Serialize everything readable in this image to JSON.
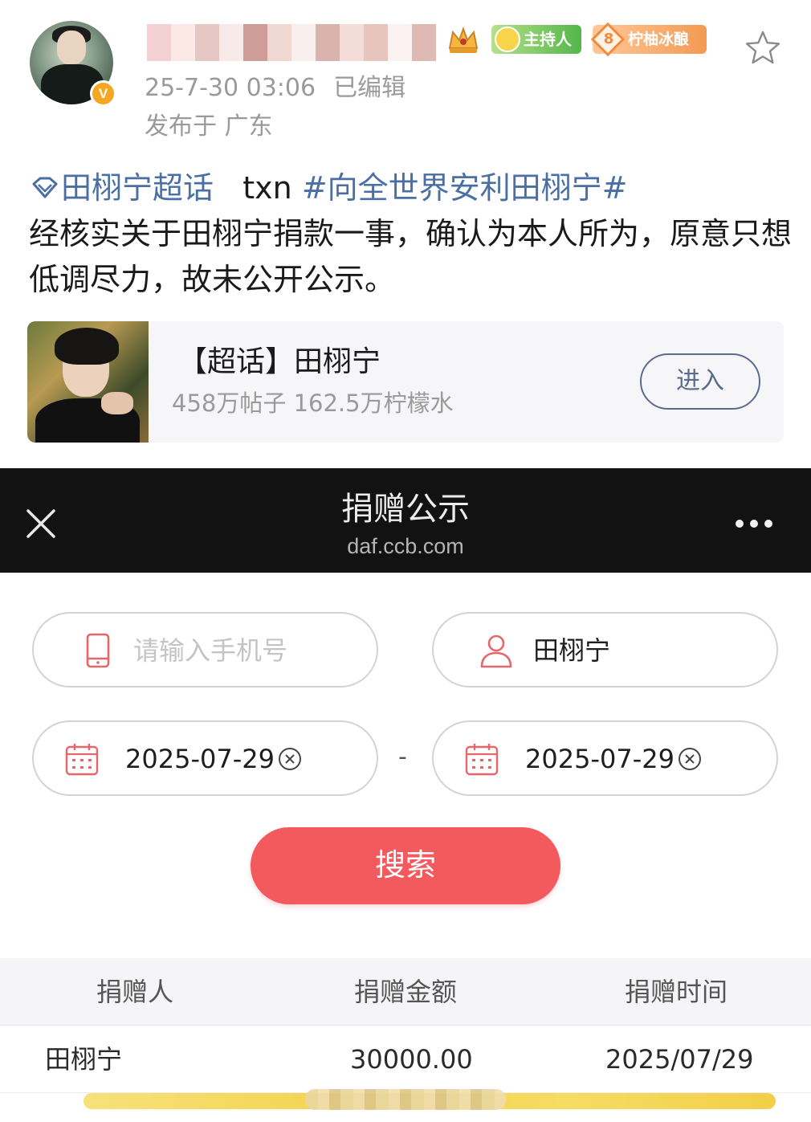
{
  "post": {
    "timestamp": "25-7-30 03:06",
    "edited_label": "已编辑",
    "location": "发布于 广东",
    "badges": {
      "host": "主持人",
      "level_number": "8",
      "level_name": "柠柚冰酿"
    },
    "text": {
      "topic_label": "田栩宁超话",
      "prefix": "txn",
      "hashtag": "#向全世界安利田栩宁#",
      "body": "经核实关于田栩宁捐款一事，确认为本人所为，原意只想低调尽力，故未公开公示。"
    },
    "card": {
      "title": "【超话】田栩宁",
      "stats": "458万帖子 162.5万柠檬水",
      "enter_label": "进入"
    }
  },
  "webview": {
    "title": "捐赠公示",
    "url": "daf.ccb.com",
    "phone_placeholder": "请输入手机号",
    "name_value": "田栩宁",
    "date_from": "2025-07-29",
    "date_to": "2025-07-29",
    "range_separator": "-",
    "search_label": "搜索",
    "table": {
      "headers": [
        "捐赠人",
        "捐赠金额",
        "捐赠时间"
      ],
      "rows": [
        {
          "donor": "田栩宁",
          "amount": "30000.00",
          "date": "2025/07/29"
        }
      ]
    }
  },
  "colors": {
    "link": "#4a6fa5",
    "search_button": "#f25a5e",
    "field_icon": "#e5676b",
    "titlebar": "#121212"
  },
  "icons": [
    "avatar",
    "verified-v-icon",
    "crown-icon",
    "host-badge-icon",
    "level-diamond-icon",
    "star-icon",
    "supertopic-diamond-icon",
    "close-icon",
    "more-icon",
    "phone-icon",
    "user-icon",
    "calendar-icon",
    "clear-icon"
  ]
}
